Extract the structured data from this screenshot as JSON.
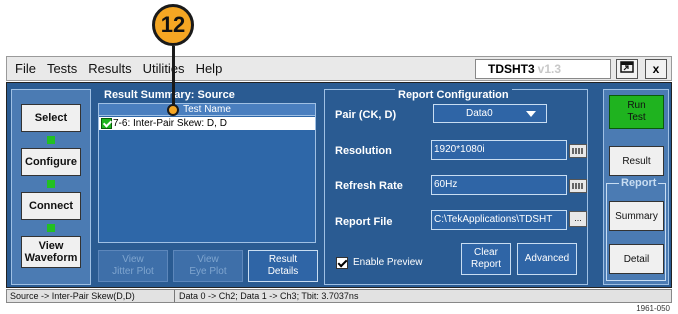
{
  "callout": {
    "number": "12"
  },
  "menubar": {
    "items": [
      "File",
      "Tests",
      "Results",
      "Utilities",
      "Help"
    ]
  },
  "app": {
    "title": "TDSHT3",
    "version": "v1.3"
  },
  "window_buttons": {
    "minimize": "",
    "close": "x"
  },
  "nav": {
    "select": "Select",
    "configure": "Configure",
    "connect": "Connect",
    "view_waveform": "View\nWaveform"
  },
  "result_summary": {
    "title": "Result Summary: Source",
    "column": "Test Name",
    "rows": [
      {
        "name": "7-6: Inter-Pair Skew: D, D",
        "checked": true
      }
    ],
    "buttons": {
      "view_jitter": "View\nJitter Plot",
      "view_eye": "View\nEye Plot",
      "result_details": "Result\nDetails"
    }
  },
  "report_config": {
    "title": "Report Configuration",
    "pair_label": "Pair (CK, D)",
    "pair_value": "Data0",
    "resolution_label": "Resolution",
    "resolution_value": "1920*1080i",
    "refresh_label": "Refresh Rate",
    "refresh_value": "60Hz",
    "report_file_label": "Report File",
    "report_file_value": "C:\\TekApplications\\TDSHT",
    "browse": "...",
    "enable_preview": "Enable Preview",
    "clear_report": "Clear\nReport",
    "advanced": "Advanced"
  },
  "right": {
    "run_test": "Run\nTest",
    "result": "Result",
    "report_group": "Report",
    "summary": "Summary",
    "detail": "Detail"
  },
  "status": {
    "left": "Source -> Inter-Pair Skew(D,D)",
    "right": "Data 0 -> Ch2; Data 1 -> Ch3; Tbit: 3.7037ns"
  },
  "figure_id": "1961-050",
  "colors": {
    "panel_blue": "#2a5b92",
    "accent_green": "#1fb31f",
    "callout_orange": "#f5a623"
  }
}
